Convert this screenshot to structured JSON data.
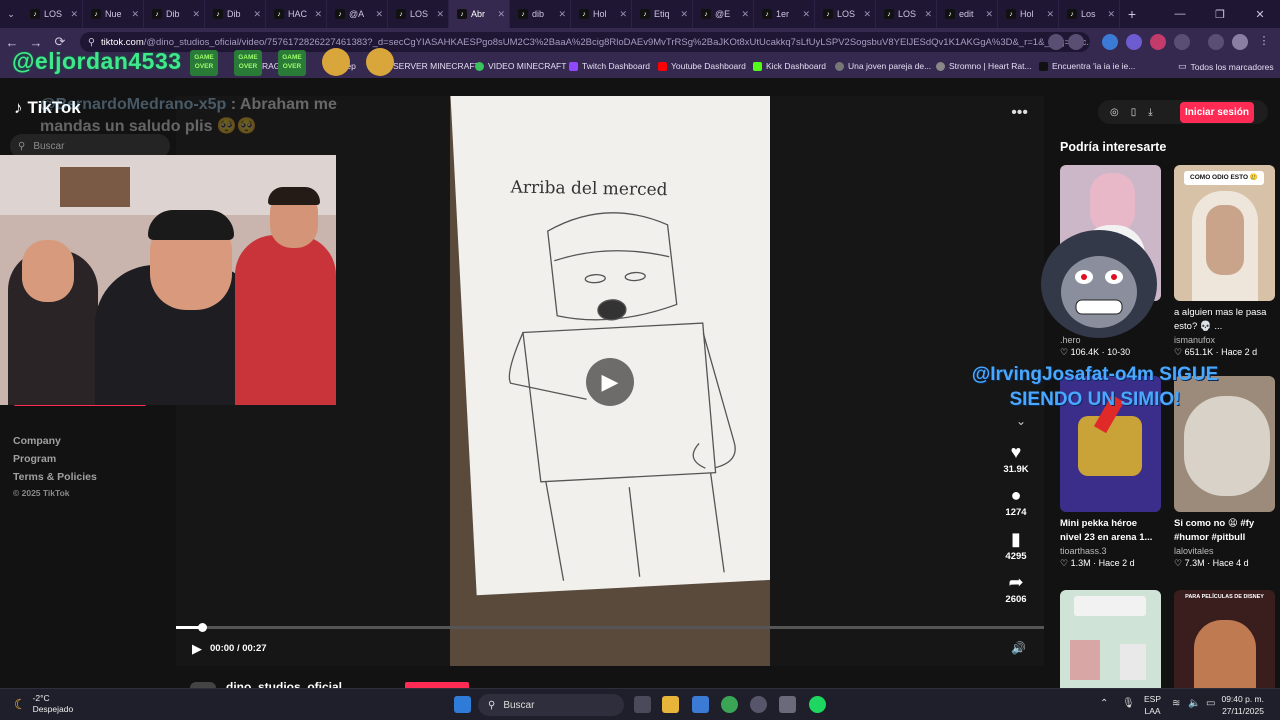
{
  "browser": {
    "tabs": [
      {
        "label": "LOS",
        "active": false
      },
      {
        "label": "Nue",
        "active": false
      },
      {
        "label": "Dib",
        "active": false
      },
      {
        "label": "Dib",
        "active": false
      },
      {
        "label": "HAC",
        "active": false
      },
      {
        "label": "@A",
        "active": false
      },
      {
        "label": "LOS",
        "active": false
      },
      {
        "label": "Abr",
        "active": true
      },
      {
        "label": "dib",
        "active": false
      },
      {
        "label": "Hol",
        "active": false
      },
      {
        "label": "Etiq",
        "active": false
      },
      {
        "label": "@E",
        "active": false
      },
      {
        "label": "1er",
        "active": false
      },
      {
        "label": "LOS",
        "active": false
      },
      {
        "label": "LOS",
        "active": false
      },
      {
        "label": "edit",
        "active": false
      },
      {
        "label": "Hol",
        "active": false
      },
      {
        "label": "Los",
        "active": false
      }
    ],
    "new_tab_symbol": "+",
    "url_host": "tiktok.com",
    "url_rest": "/@dino_studios_oficial/video/7576172826227461383?_d=secCgYIASAHKAESPgo8sUM2C3%2BaaA%2Bcig8RloDAEv9MvTrRSg%2BaJKOt8xUtUcakkq7sLfUyLSPV2SogsbuV8YElJESdQv1K1AKGgA%3D&_r=1&_svg=1&c...",
    "bookmarks": [
      "RAG",
      "Keep",
      "SERVER MINECRAFT",
      "VIDEO MINECRAFT",
      "Twitch Dashboard",
      "Youtube Dashboard",
      "Kick Dashboard",
      "Una joven pareja de...",
      "Stromno | Heart Rat...",
      "Encuentra 'ia ia ie ie...",
      "Todos los marcadores"
    ],
    "bookmark_partial": "hes"
  },
  "tiktok": {
    "logo_text": "TikTok",
    "search_placeholder": "Buscar",
    "footer_links": [
      "Company",
      "Program",
      "Terms & Policies"
    ],
    "copyright": "© 2025 TikTok",
    "video": {
      "drawing_caption": "Arriba del merced",
      "current_time": "00:00",
      "duration": "00:27",
      "time_display": "00:00 / 00:27",
      "progress_fraction": 0.03,
      "author": "dino_studios_oficial"
    },
    "actions": {
      "likes": "31.9K",
      "comments": "1274",
      "saves": "4295",
      "shares": "2606"
    },
    "header": {
      "login_button": "Iniciar sesión"
    },
    "recommendations_title": "Podría interesarte",
    "recommendations": [
      {
        "title": "",
        "user": ".hero",
        "likes": "106.4K",
        "age": "10-30",
        "thumb_text": ""
      },
      {
        "title": "a alguien mas le pasa esto? 💀 ...",
        "user": "ismanufox",
        "likes": "651.1K",
        "age": "Hace 2 d",
        "thumb_text": "COMO ODIO ESTO 🥲"
      },
      {
        "title": "Mini pekka héroe nivel 23 en arena 1...",
        "user": "tioarthass.3",
        "likes": "1.3M",
        "age": "Hace 2 d",
        "thumb_text": ""
      },
      {
        "title": "Si como no 😫 #fy #humor #pitbull",
        "user": "lalovitales",
        "likes": "7.3M",
        "age": "Hace 4 d",
        "thumb_text": ""
      },
      {
        "title": "",
        "user": "",
        "likes": "",
        "age": "",
        "thumb_text": ""
      },
      {
        "title": "",
        "user": "",
        "likes": "",
        "age": "",
        "thumb_text": "PARA PELÍCULAS DE DISNEY"
      }
    ]
  },
  "stream_overlay": {
    "streamer_handle": "@eljordan4533",
    "separator": ":",
    "emote_text": "GAME OVER",
    "chat_user": "@BernardoMedrano-x5p",
    "chat_message": ": Abraham me mandas un saludo plis 🥺🥺",
    "alert_line1": "@IrvingJosafat-o4m SIGUE",
    "alert_line2": "SIENDO UN SIMIO!"
  },
  "taskbar": {
    "temperature": "-2°C",
    "weather": "Despejado",
    "search_label": "Buscar",
    "lang_top": "ESP",
    "lang_bottom": "LAA",
    "time": "09:40 p. m.",
    "date": "27/11/2025"
  },
  "colors": {
    "tiktok_red": "#fe2c55",
    "chrome_frame": "#1f1633",
    "chrome_toolbar": "#35294f",
    "overlay_green": "#40e88c",
    "overlay_blue": "#4aa8ff"
  },
  "icons": [
    "tiktok-icon",
    "search-icon",
    "play-icon",
    "more-icon",
    "heart-icon",
    "comment-icon",
    "bookmark-icon",
    "share-icon",
    "volume-icon",
    "chevron-down-icon",
    "download-icon",
    "phone-icon",
    "compass-icon",
    "windows-icon",
    "chrome-icon",
    "spotify-icon",
    "wifi-icon",
    "battery-icon"
  ]
}
